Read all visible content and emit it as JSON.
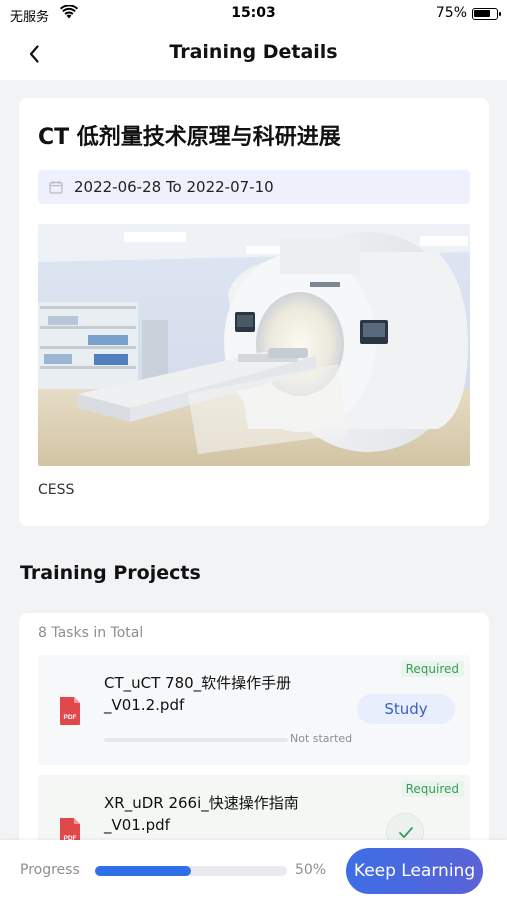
{
  "status_bar": {
    "carrier": "无服务",
    "time": "15:03",
    "battery": "75%",
    "battery_level": 0.75
  },
  "nav": {
    "title": "Training Details",
    "back_icon": "chevron-left-icon"
  },
  "course": {
    "title": "CT 低剂量技术原理与科研进展",
    "date_range": "2022-06-28 To 2022-07-10",
    "source": "CESS"
  },
  "projects": {
    "section_title": "Training Projects",
    "task_count": "8 Tasks in Total",
    "tasks": [
      {
        "name": "CT_uCT 780_软件操作手册_V01.2.pdf",
        "tag": "Required",
        "status": "Not started",
        "progress": 0,
        "action": "Study",
        "icon": "pdf-icon"
      },
      {
        "name": "XR_uDR 266i_快速操作指南_V01.pdf",
        "tag": "Required",
        "completed": true,
        "icon": "pdf-icon"
      }
    ]
  },
  "footer": {
    "progress_label": "Progress",
    "progress_value": "50%",
    "progress_fraction": 0.5,
    "button_label": "Keep Learning"
  },
  "colors": {
    "accent": "#3a6fe0",
    "required_green": "#3a9a5c",
    "pdf_red": "#e0494b",
    "date_pill_bg": "#eef0fb"
  }
}
